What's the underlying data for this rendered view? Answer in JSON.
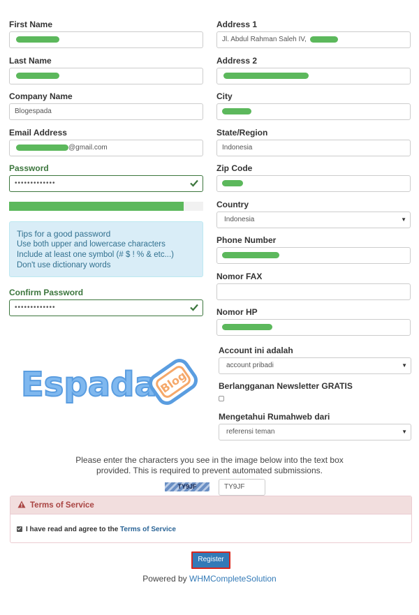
{
  "left": {
    "first_name": {
      "label": "First Name"
    },
    "last_name": {
      "label": "Last Name"
    },
    "company": {
      "label": "Company Name",
      "value": "Blogespada"
    },
    "email": {
      "label": "Email Address",
      "value_suffix": "@gmail.com"
    },
    "password": {
      "label": "Password",
      "value": "•••••••••••••"
    },
    "strength_percent": 90,
    "tips": {
      "title": "Tips for a good password",
      "lines": [
        "Use both upper and lowercase characters",
        "Include at least one symbol (# $ ! % & etc...)",
        "Don't use dictionary words"
      ]
    },
    "confirm_password": {
      "label": "Confirm Password",
      "value": "•••••••••••••"
    }
  },
  "right": {
    "address1": {
      "label": "Address 1",
      "value_prefix": "Jl. Abdul Rahman Saleh IV,"
    },
    "address2": {
      "label": "Address 2"
    },
    "city": {
      "label": "City"
    },
    "state": {
      "label": "State/Region",
      "value": "Indonesia"
    },
    "zip": {
      "label": "Zip Code"
    },
    "country": {
      "label": "Country",
      "value": "Indonesia"
    },
    "phone": {
      "label": "Phone Number"
    },
    "fax": {
      "label": "Nomor FAX",
      "value": ""
    },
    "hp": {
      "label": "Nomor HP"
    },
    "account_type": {
      "label": "Account ini adalah",
      "value": "account pribadi"
    },
    "newsletter": {
      "label": "Berlangganan Newsletter GRATIS",
      "checked": false
    },
    "referral": {
      "label": "Mengetahui Rumahweb dari",
      "value": "referensi teman"
    }
  },
  "logo": {
    "text": "Espada",
    "badge": "Blog"
  },
  "captcha": {
    "instructions_line1": "Please enter the characters you see in the image below into the text box",
    "instructions_line2": "provided. This is required to prevent automated submissions.",
    "image_text": "TY9JF",
    "input_value": "TY9JF"
  },
  "tos": {
    "heading": "Terms of Service",
    "agree_text": "I have read and agree to the",
    "link_text": "Terms of Service",
    "checked": true
  },
  "register_label": "Register",
  "footer": {
    "prefix": "Powered by",
    "link": "WHMCompleteSolution"
  },
  "colors": {
    "redaction": "#5cb85c",
    "success": "#3c763d",
    "primary": "#337ab7",
    "danger": "#a94442",
    "info_bg": "#d9edf7"
  }
}
